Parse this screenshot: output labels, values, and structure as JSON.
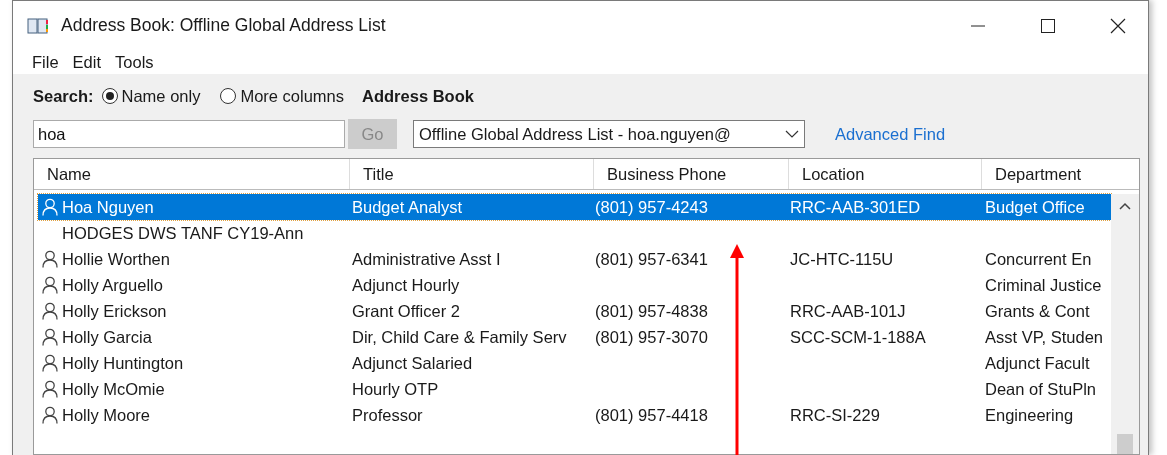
{
  "window": {
    "title": "Address Book: Offline Global Address List"
  },
  "menu": [
    "File",
    "Edit",
    "Tools"
  ],
  "search": {
    "label": "Search:",
    "options": [
      {
        "label": "Name only",
        "selected": true
      },
      {
        "label": "More columns",
        "selected": false
      }
    ],
    "value": "hoa",
    "go": {
      "label": "Go",
      "disabled": true
    }
  },
  "address_book": {
    "label": "Address Book",
    "value": "Offline Global Address List - hoa.nguyen@",
    "advanced_find": "Advanced Find"
  },
  "table": {
    "columns": [
      "Name",
      "Title",
      "Business Phone",
      "Location",
      "Department"
    ],
    "rows": [
      {
        "kind": "person",
        "selected": true,
        "cells": [
          "Hoa Nguyen",
          "Budget Analyst",
          "(801) 957-4243",
          "RRC-AAB-301ED",
          "Budget Office"
        ]
      },
      {
        "kind": "list",
        "selected": false,
        "cells": [
          "HODGES DWS TANF CY19-Ann",
          "",
          "",
          "",
          ""
        ]
      },
      {
        "kind": "person",
        "selected": false,
        "cells": [
          "Hollie Worthen",
          "Administrative Asst I",
          "(801) 957-6341",
          "JC-HTC-115U",
          "Concurrent En"
        ]
      },
      {
        "kind": "person",
        "selected": false,
        "cells": [
          "Holly Arguello",
          "Adjunct Hourly",
          "",
          "",
          "Criminal Justice"
        ]
      },
      {
        "kind": "person",
        "selected": false,
        "cells": [
          "Holly Erickson",
          "Grant Officer 2",
          "(801) 957-4838",
          "RRC-AAB-101J",
          "Grants & Cont"
        ]
      },
      {
        "kind": "person",
        "selected": false,
        "cells": [
          "Holly Garcia",
          "Dir, Child Care & Family Serv",
          "(801) 957-3070",
          "SCC-SCM-1-188A",
          "Asst VP, Studen"
        ]
      },
      {
        "kind": "person",
        "selected": false,
        "cells": [
          "Holly Huntington",
          "Adjunct Salaried",
          "",
          "",
          "Adjunct Facult"
        ]
      },
      {
        "kind": "person",
        "selected": false,
        "cells": [
          "Holly McOmie",
          "Hourly OTP",
          "",
          "",
          "Dean of StuPln"
        ]
      },
      {
        "kind": "person",
        "selected": false,
        "cells": [
          "Holly Moore",
          "Professor",
          "(801) 957-4418",
          "RRC-SI-229",
          "Engineering"
        ]
      }
    ]
  }
}
